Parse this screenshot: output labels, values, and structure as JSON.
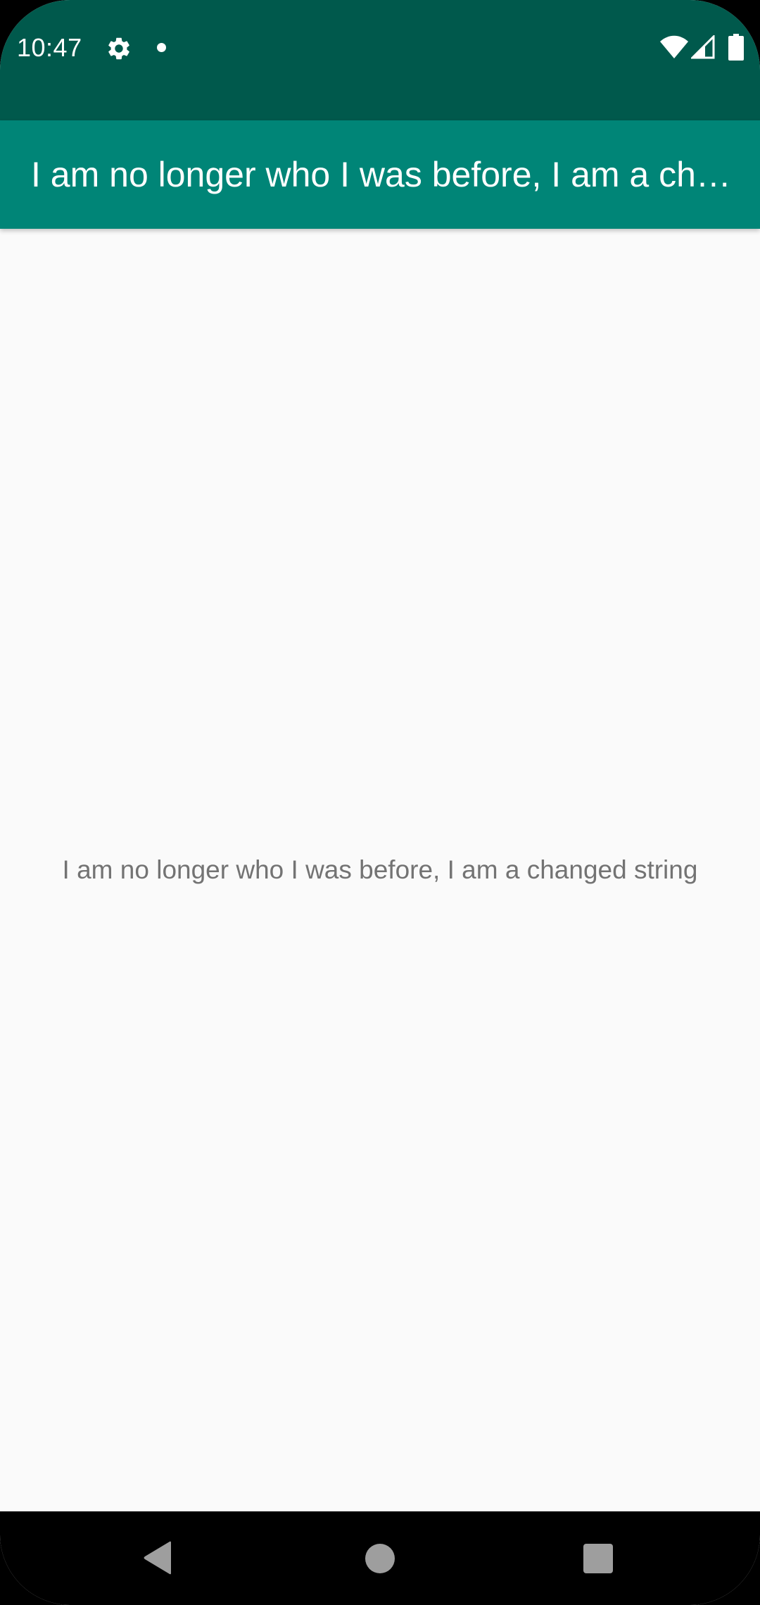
{
  "status_bar": {
    "time": "10:47",
    "icons": [
      "settings-gear-icon",
      "notification-dot-icon",
      "wifi-icon",
      "cell-signal-icon",
      "battery-icon"
    ]
  },
  "app_bar": {
    "title": "I am no longer who I was before, I am a changed string",
    "background": "#008577"
  },
  "main": {
    "message": "I am no longer who I was before, I am a changed string"
  },
  "nav_bar": {
    "icons": [
      "back-icon",
      "home-icon",
      "recents-icon"
    ]
  },
  "colors": {
    "status_bar": "#00594c",
    "app_bar": "#008577",
    "content_bg": "#fafafa",
    "message_text": "#737373"
  }
}
